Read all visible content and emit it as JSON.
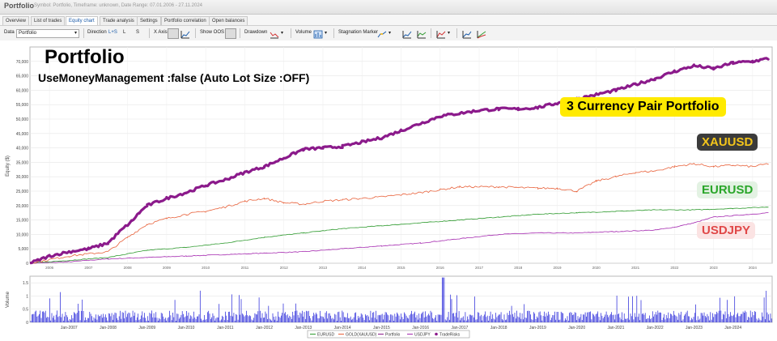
{
  "window": {
    "title": "Portfolio",
    "subtitle": "Symbol: Portfolio, Timeframe: unknown, Date Range: 07.01.2006 - 27.11.2024"
  },
  "tabs": [
    "Overview",
    "List of trades",
    "Equity chart",
    "Trade analysis",
    "Settings",
    "Portfolio correlation",
    "Open balances"
  ],
  "active_tab": "Equity chart",
  "toolbar": {
    "data_label": "Data",
    "data_value": "Portfolio",
    "direction_label": "Direction",
    "direction_opts": [
      "L+S",
      "L",
      "S"
    ],
    "xaxis_label": "X Axis",
    "showoos_label": "Show OOS",
    "drawdown_label": "Drawdown",
    "volume_label": "Volume",
    "stagnation_label": "Stagnation Marker"
  },
  "overlay": {
    "title": "Portfolio",
    "subtitle": "UseMoneyManagement :false (Auto Lot Size :OFF)",
    "badge_portfolio": "3 Currency Pair Portfolio",
    "badge_xauusd": "XAUUSD",
    "badge_eurusd": "EURUSD",
    "badge_usdjpy": "USDJPY"
  },
  "colors": {
    "portfolio": "#8b1a8b",
    "xauusd": "#e8613a",
    "eurusd": "#2e9a2e",
    "usdjpy": "#a52ab0",
    "volume": "#1f1fd8",
    "badge_yellow": "#ffea00"
  },
  "chart_data": [
    {
      "type": "line",
      "ylabel": "Equity ($)",
      "ylim": [
        0,
        75000
      ],
      "yticks": [
        0,
        5000,
        10000,
        15000,
        20000,
        25000,
        30000,
        35000,
        40000,
        45000,
        50000,
        55000,
        60000,
        65000,
        70000
      ],
      "ytick_labels": [
        "0",
        "5,000",
        "10,000",
        "15,000",
        "20,000",
        "25,000",
        "30,000",
        "35,000",
        "40,000",
        "45,000",
        "50,000",
        "55,000",
        "60,000",
        "65,000",
        "70,000"
      ],
      "xlim": [
        2006.0,
        2025.0
      ],
      "xtick_years": [
        2006,
        2007,
        2008,
        2009,
        2010,
        2011,
        2012,
        2013,
        2014,
        2015,
        2016,
        2017,
        2018,
        2019,
        2020,
        2021,
        2022,
        2023,
        2024
      ],
      "xtick_labels": [
        "2006",
        "2007",
        "2008",
        "2009",
        "2010",
        "2011",
        "2012",
        "2013",
        "2014",
        "2015",
        "2016",
        "2017",
        "2018",
        "2019",
        "2020",
        "2021",
        "2022",
        "2023",
        "2024"
      ],
      "grid": true,
      "series": [
        {
          "name": "Portfolio",
          "x": [
            2006.0,
            2006.5,
            2007.0,
            2007.5,
            2008.0,
            2008.3,
            2008.6,
            2008.8,
            2009.0,
            2009.5,
            2010.0,
            2010.5,
            2011.0,
            2011.5,
            2012.0,
            2012.5,
            2013.0,
            2013.5,
            2014.0,
            2014.5,
            2015.0,
            2015.5,
            2016.0,
            2016.5,
            2017.0,
            2017.5,
            2018.0,
            2018.5,
            2019.0,
            2019.5,
            2020.0,
            2020.5,
            2021.0,
            2021.5,
            2022.0,
            2022.5,
            2023.0,
            2023.5,
            2024.0,
            2024.5,
            2024.9
          ],
          "values": [
            0,
            2500,
            4000,
            5000,
            7000,
            11000,
            14500,
            17500,
            20000,
            22500,
            24500,
            27000,
            29000,
            31500,
            33500,
            36500,
            39500,
            40000,
            40500,
            42000,
            43500,
            46000,
            48500,
            51000,
            52000,
            53000,
            53500,
            53500,
            54000,
            55500,
            57000,
            58500,
            60000,
            62000,
            64000,
            66500,
            68500,
            67500,
            69500,
            70000,
            71000
          ]
        },
        {
          "name": "GOLD(XAUUSD)",
          "x": [
            2006.0,
            2007.0,
            2008.0,
            2008.5,
            2009.0,
            2009.5,
            2010.0,
            2010.5,
            2011.0,
            2011.5,
            2012.0,
            2012.5,
            2013.0,
            2013.5,
            2014.0,
            2015.0,
            2016.0,
            2016.5,
            2017.0,
            2018.0,
            2019.0,
            2019.5,
            2020.0,
            2020.5,
            2021.0,
            2021.5,
            2022.0,
            2022.5,
            2023.0,
            2023.5,
            2024.0,
            2024.5,
            2024.9
          ],
          "values": [
            0,
            2500,
            4000,
            9000,
            13500,
            15500,
            17000,
            18000,
            19500,
            21500,
            22500,
            21000,
            20500,
            21500,
            22000,
            23000,
            24500,
            25500,
            26500,
            26500,
            26000,
            26000,
            25000,
            28500,
            30000,
            31500,
            32000,
            33500,
            34500,
            33500,
            34000,
            33500,
            34500
          ]
        },
        {
          "name": "EURUSD",
          "x": [
            2006.0,
            2007.0,
            2008.0,
            2009.0,
            2010.0,
            2011.0,
            2012.0,
            2013.0,
            2014.0,
            2015.0,
            2016.0,
            2017.0,
            2018.0,
            2019.0,
            2020.0,
            2021.0,
            2022.0,
            2023.0,
            2024.0,
            2024.9
          ],
          "values": [
            0,
            1000,
            2000,
            4500,
            5500,
            7000,
            9000,
            10500,
            12000,
            13000,
            14000,
            15000,
            16000,
            17000,
            17500,
            18000,
            18500,
            18500,
            19000,
            19500
          ]
        },
        {
          "name": "USDJPY",
          "x": [
            2006.0,
            2007.0,
            2008.0,
            2009.0,
            2010.0,
            2011.0,
            2012.0,
            2013.0,
            2014.0,
            2015.0,
            2016.0,
            2017.0,
            2018.0,
            2019.0,
            2020.0,
            2021.0,
            2022.0,
            2022.5,
            2023.0,
            2023.5,
            2024.0,
            2024.9
          ],
          "values": [
            0,
            500,
            1500,
            2000,
            2500,
            3000,
            3500,
            4000,
            5000,
            6000,
            7000,
            8500,
            10000,
            10500,
            10500,
            11000,
            11500,
            12500,
            14000,
            16000,
            16500,
            17500
          ]
        }
      ]
    },
    {
      "type": "bar",
      "ylabel": "Volume",
      "ylim": [
        0,
        1.75
      ],
      "yticks": [
        0,
        0.5,
        1.0,
        1.5
      ],
      "ytick_labels": [
        "0",
        "0.5",
        "1",
        "1.5"
      ],
      "xlim": [
        2006.0,
        2025.0
      ],
      "xtick_labels": [
        "Jan-2007",
        "Jan-2008",
        "Jan-2009",
        "Jan-2010",
        "Jan-2011",
        "Jan-2012",
        "Jan-2013",
        "Jan-2014",
        "Jan-2015",
        "Jan-2016",
        "Jan-2017",
        "Jan-2018",
        "Jan-2019",
        "Jan-2020",
        "Jan-2021",
        "Jan-2022",
        "Jan-2023",
        "Jan-2024"
      ],
      "typical_value": 0.3,
      "max_value": 1.7
    }
  ],
  "legend": [
    "EURUSD",
    "GOLD(XAUUSD)",
    "Portfolio",
    "USDJPY",
    "TradeRisks"
  ]
}
